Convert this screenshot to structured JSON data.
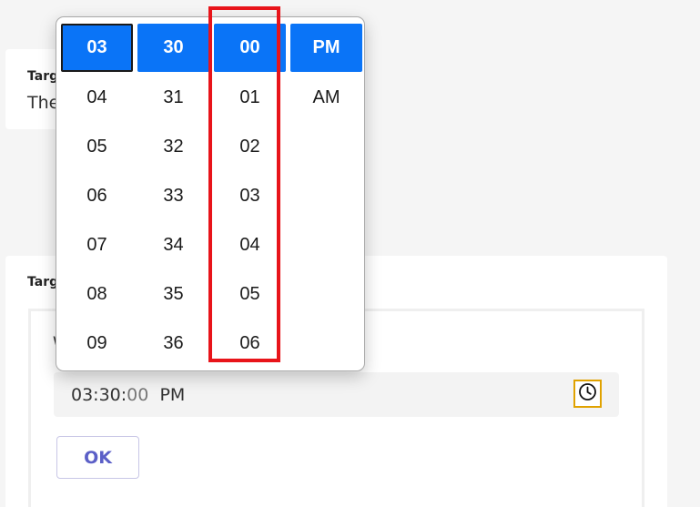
{
  "card_top": {
    "label": "Targ",
    "text": "The"
  },
  "card_bottom": {
    "label": "Targ"
  },
  "inner": {
    "label": "W"
  },
  "time_input": {
    "hm": "03:30:",
    "sec": "00",
    "period": "PM"
  },
  "ok_label": "OK",
  "picker": {
    "hours": [
      "03",
      "04",
      "05",
      "06",
      "07",
      "08",
      "09"
    ],
    "minutes": [
      "30",
      "31",
      "32",
      "33",
      "34",
      "35",
      "36"
    ],
    "seconds": [
      "00",
      "01",
      "02",
      "03",
      "04",
      "05",
      "06"
    ],
    "periods": [
      "PM",
      "AM"
    ]
  },
  "colors": {
    "accent": "#0a74f7",
    "highlight": "#e8141a",
    "focus": "#e0a200"
  }
}
